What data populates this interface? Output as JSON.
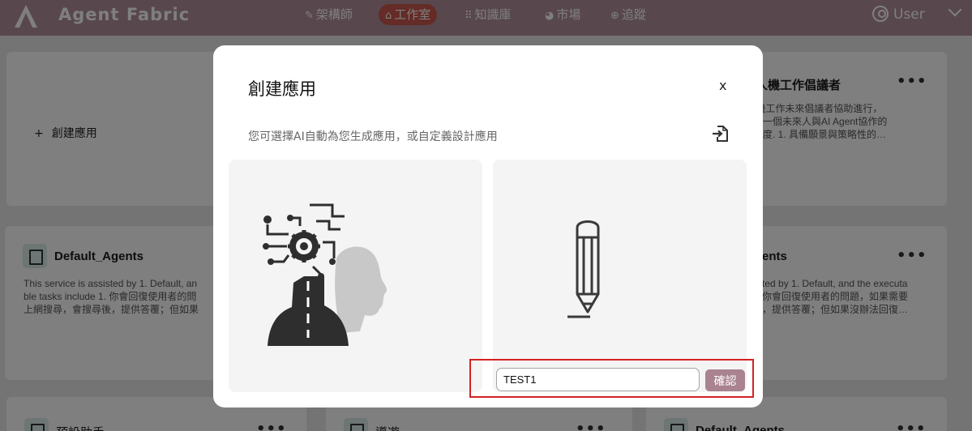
{
  "app": {
    "brand": "Agent Fabric",
    "nav": [
      {
        "label": "架構師",
        "icon": "wand-icon"
      },
      {
        "label": "工作室",
        "icon": "robot-icon"
      },
      {
        "label": "知識庫",
        "icon": "grid-icon"
      },
      {
        "label": "市場",
        "icon": "globe-icon"
      },
      {
        "label": "追蹤",
        "icon": "magnify-icon"
      }
    ],
    "active_nav": "工作室",
    "user_label": "User"
  },
  "cards": {
    "add": {
      "label": "創建應用"
    },
    "top_right": {
      "title": "來人機工作倡議者",
      "desc": [
        "t人機工作未來倡議者協助進行，",
        "你是一個未來人與AI Agent協作的",
        "略高度. 1. 具備願景與策略性的…"
      ]
    },
    "mid_left": {
      "title": "Default_Agents",
      "desc": [
        "This service is assisted by 1. Default, an",
        "ble tasks include 1. 你會回復使用者的問",
        "上網搜尋，會搜尋後，提供答覆；但如果"
      ]
    },
    "mid_right": {
      "title": "ents",
      "desc": [
        "ted by 1. Default, and the executa",
        "你會回復使用者的問題，如果需要",
        "，提供答覆；但如果沒辦法回復…"
      ]
    },
    "bottom": [
      {
        "title": "預設助手"
      },
      {
        "title": "導遊"
      },
      {
        "title": "Default_Agents"
      }
    ],
    "more": "•••"
  },
  "modal": {
    "title": "創建應用",
    "close": "x",
    "subtitle": "您可選擇AI自動為您生成應用，或自定義設計應用",
    "input_value": "TEST1",
    "confirm_label": "確認"
  },
  "colors": {
    "nav_bg": "#b18f9b",
    "nav_active": "#c9574f",
    "confirm_bg": "#a9838f",
    "highlight": "#d42222"
  }
}
